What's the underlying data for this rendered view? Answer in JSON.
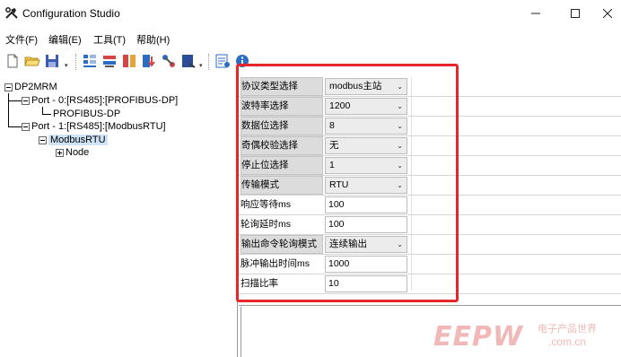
{
  "window": {
    "title": "Configuration Studio",
    "minimize_icon": "minimize-icon",
    "maximize_icon": "maximize-icon",
    "close_icon": "close-icon"
  },
  "menu": {
    "items": [
      "文件(F)",
      "编辑(E)",
      "工具(T)",
      "帮助(H)"
    ]
  },
  "toolbar": {
    "icons": [
      "new-file-icon",
      "open-folder-icon",
      "save-icon",
      "grid-icon",
      "device-icon",
      "module-icon",
      "download-icon",
      "wrench-icon",
      "import-icon",
      "settings-icon",
      "info-icon"
    ]
  },
  "tree": {
    "root": "DP2MRM",
    "port0": "Port - 0:[RS485]:[PROFIBUS-DP]",
    "port0_child": "PROFIBUS-DP",
    "port1": "Port - 1:[RS485]:[ModbusRTU]",
    "port1_child": "ModbusRTU",
    "node": "Node"
  },
  "properties": [
    {
      "label": "协议类型选择",
      "value": "modbus主站",
      "type": "combo"
    },
    {
      "label": "波特率选择",
      "value": "1200",
      "type": "combo"
    },
    {
      "label": "数据位选择",
      "value": "8",
      "type": "combo"
    },
    {
      "label": "奇偶校验选择",
      "value": "无",
      "type": "combo"
    },
    {
      "label": "停止位选择",
      "value": "1",
      "type": "combo"
    },
    {
      "label": "传输模式",
      "value": "RTU",
      "type": "combo"
    },
    {
      "label": "响应等待ms",
      "value": "100",
      "type": "text"
    },
    {
      "label": "轮询延时ms",
      "value": "100",
      "type": "text"
    },
    {
      "label": "输出命令轮询模式",
      "value": "连续输出",
      "type": "combo"
    },
    {
      "label": "脉冲输出时间ms",
      "value": "1000",
      "type": "text"
    },
    {
      "label": "扫描比率",
      "value": "10",
      "type": "text"
    }
  ],
  "watermark": {
    "logo": "EEPW",
    "cn": "电子产品世界",
    "url": ".com.cn"
  },
  "colors": {
    "highlight": "#e6262a",
    "selection": "#cfe3f7"
  }
}
